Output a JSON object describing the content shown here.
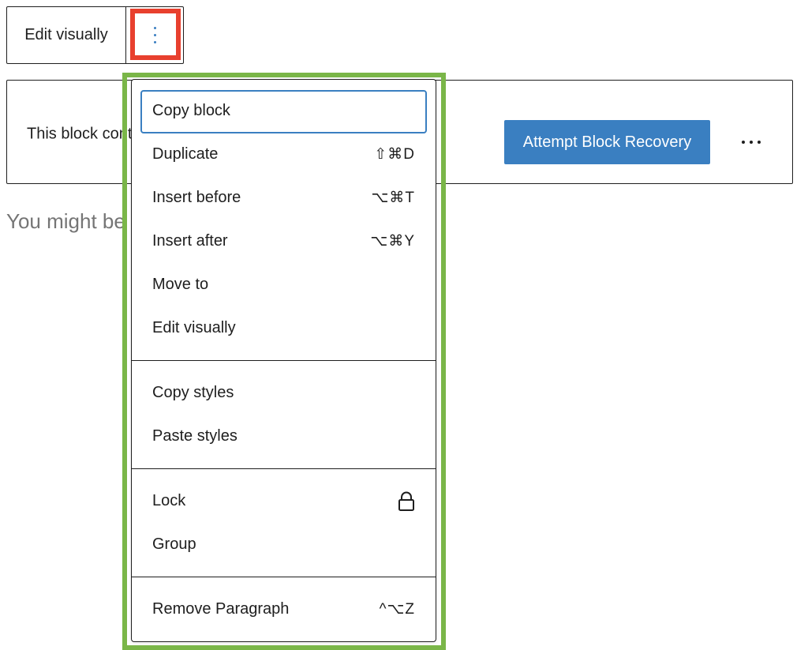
{
  "toolbar": {
    "edit_label": "Edit visually",
    "more_icon": "kebab-vertical-icon"
  },
  "block": {
    "warning_text": "This block contains unexpected or invalid content.",
    "recovery_button": "Attempt Block Recovery",
    "more_icon": "ellipsis-horizontal-icon"
  },
  "hint_text": "You might be",
  "menu": {
    "groups": [
      {
        "items": [
          {
            "label": "Copy block",
            "shortcut": ""
          },
          {
            "label": "Duplicate",
            "shortcut": "⇧⌘D"
          },
          {
            "label": "Insert before",
            "shortcut": "⌥⌘T"
          },
          {
            "label": "Insert after",
            "shortcut": "⌥⌘Y"
          },
          {
            "label": "Move to",
            "shortcut": ""
          },
          {
            "label": "Edit visually",
            "shortcut": ""
          }
        ]
      },
      {
        "items": [
          {
            "label": "Copy styles",
            "shortcut": ""
          },
          {
            "label": "Paste styles",
            "shortcut": ""
          }
        ]
      },
      {
        "items": [
          {
            "label": "Lock",
            "icon": "lock-icon"
          },
          {
            "label": "Group",
            "shortcut": ""
          }
        ]
      },
      {
        "items": [
          {
            "label": "Remove Paragraph",
            "shortcut": "^⌥Z"
          }
        ]
      }
    ]
  },
  "colors": {
    "accent": "#3a7fc1",
    "highlight_red": "#e8402e",
    "highlight_green": "#7ab648"
  }
}
